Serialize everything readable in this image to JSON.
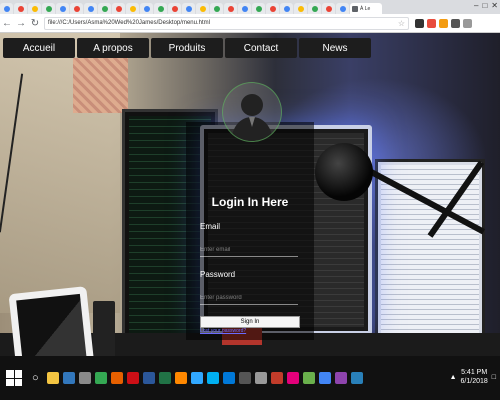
{
  "browser": {
    "active_tab_title": "À Le",
    "address": "file:///C:/Users/Asma%20Wed%20James/Desktop/menu.html",
    "window_controls": [
      "–",
      "□",
      "✕"
    ],
    "tab_icon_colors": [
      "#4285f4",
      "#ea4335",
      "#fbbc05",
      "#34a853",
      "#4285f4",
      "#ea4335",
      "#4285f4",
      "#34a853",
      "#ea4335",
      "#fbbc05",
      "#4285f4",
      "#34a853",
      "#ea4335",
      "#4285f4",
      "#fbbc05",
      "#34a853",
      "#ea4335",
      "#4285f4",
      "#34a853",
      "#ea4335",
      "#4285f4",
      "#fbbc05",
      "#34a853",
      "#ea4335",
      "#4285f4"
    ]
  },
  "nav": {
    "items": [
      "Accueil",
      "A propos",
      "Produits",
      "Contact",
      "News"
    ]
  },
  "login": {
    "title": "Login In Here",
    "email_label": "Email",
    "email_placeholder": "Enter email",
    "password_label": "Password",
    "password_placeholder": "Enter password",
    "submit_label": "Sign In",
    "link_text": "Lost your password?"
  },
  "taskbar": {
    "time": "5:41 PM",
    "date": "6/1/2018",
    "icons": [
      "file-explorer-icon",
      "edge-icon",
      "store-icon",
      "chrome-icon",
      "firefox-icon",
      "opera-icon",
      "word-icon",
      "excel-icon",
      "vlc-icon",
      "photoshop-icon",
      "skype-icon",
      "mail-icon",
      "calculator-icon",
      "settings-icon",
      "media-icon",
      "music-icon",
      "notepad-icon",
      "browser-icon",
      "app-icon",
      "app-icon"
    ],
    "icon_colors": [
      "#f4c542",
      "#3277bc",
      "#8a8a8a",
      "#34a853",
      "#e66000",
      "#cc0f16",
      "#2b579a",
      "#217346",
      "#ff8800",
      "#31a8ff",
      "#00aff0",
      "#0078d7",
      "#555",
      "#999",
      "#c23c2a",
      "#e3007a",
      "#6ab04c",
      "#4285f4",
      "#8e44ad",
      "#2980b9"
    ]
  }
}
